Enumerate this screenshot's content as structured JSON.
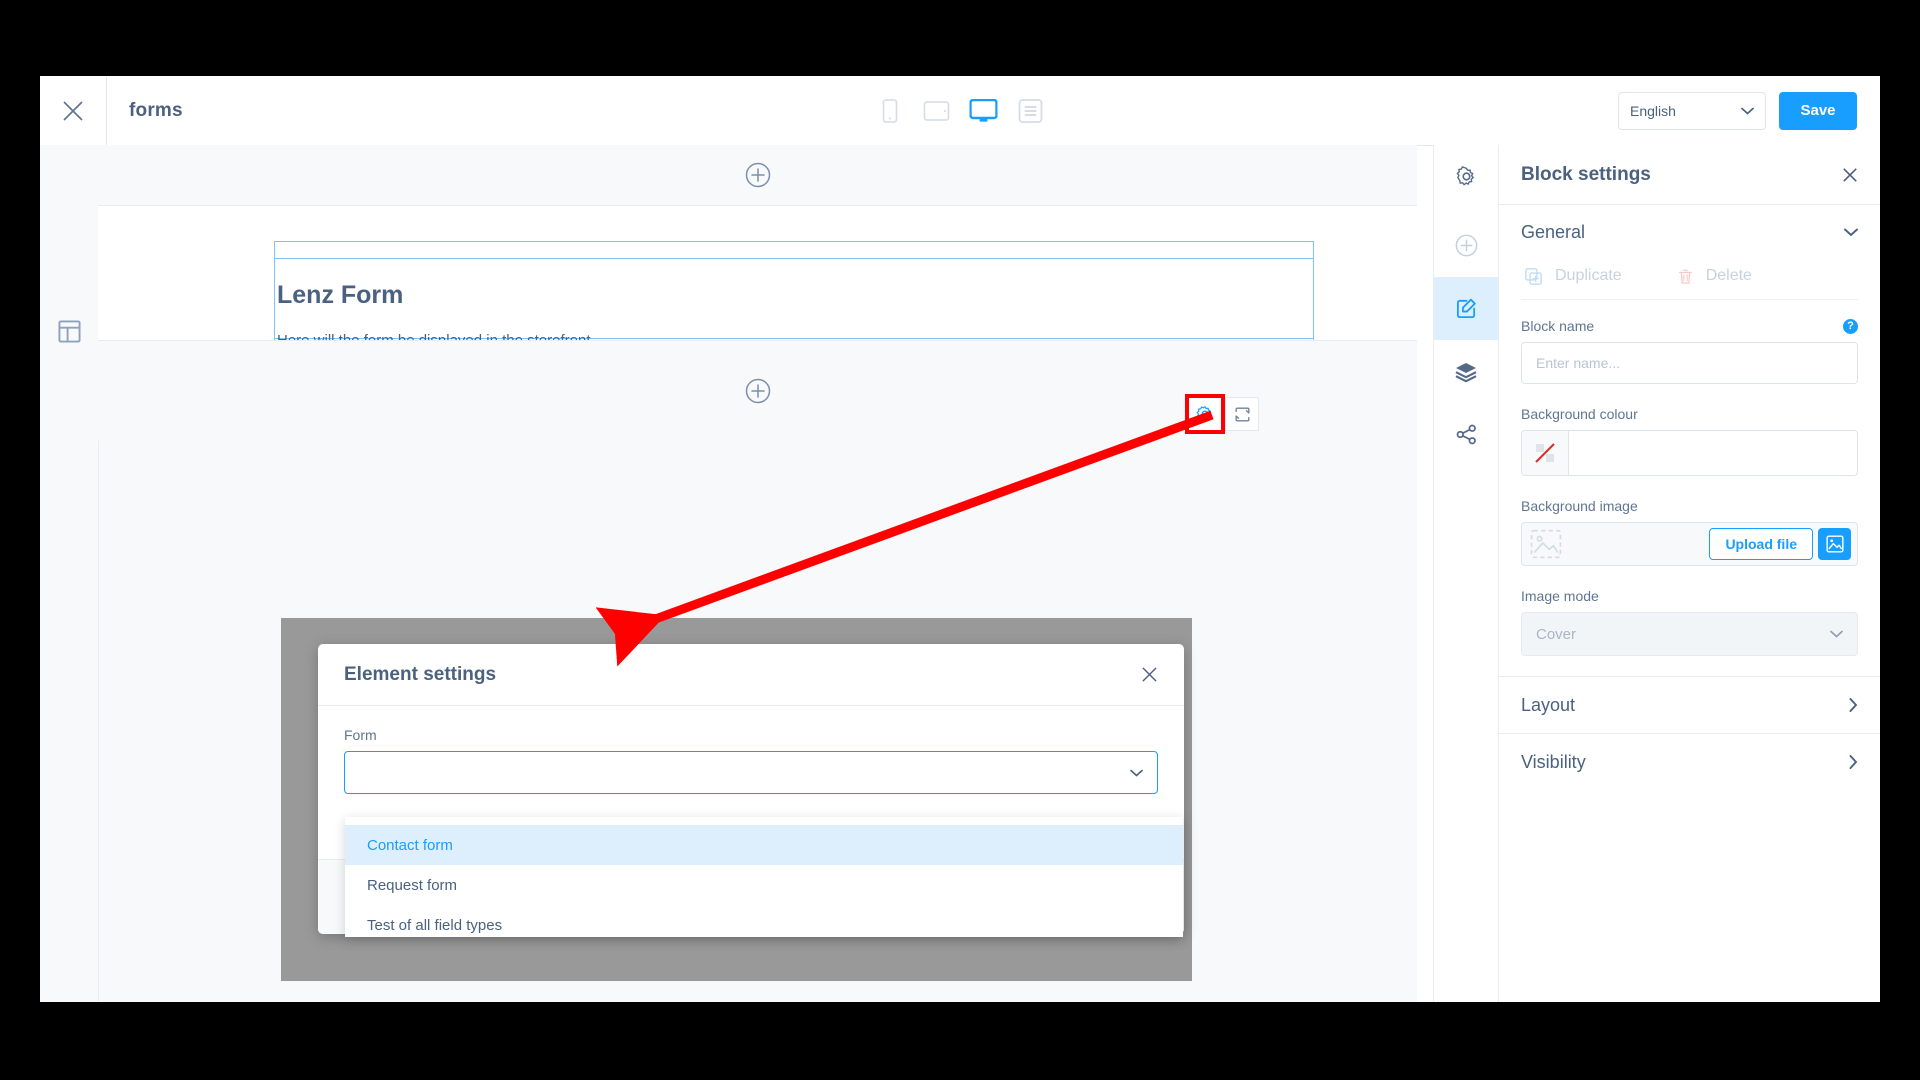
{
  "topbar": {
    "close_icon": "close-icon",
    "title": "forms",
    "devices": [
      {
        "name": "mobile-view",
        "icon": "mobile-icon",
        "active": false
      },
      {
        "name": "tablet-view",
        "icon": "tablet-icon",
        "active": false
      },
      {
        "name": "desktop-view",
        "icon": "desktop-icon",
        "active": true
      },
      {
        "name": "list-view",
        "icon": "list-icon",
        "active": false
      }
    ],
    "language": "English",
    "save_label": "Save"
  },
  "canvas": {
    "section_icon": "layout-icon",
    "add_block_label": "+",
    "block": {
      "heading": "Lenz Form",
      "description": "Here will the form be displayed in the storefront."
    },
    "tools": {
      "settings_icon": "gear-icon",
      "swap_icon": "swap-icon"
    }
  },
  "modal": {
    "title": "Element settings",
    "close_icon": "close-icon",
    "field_label": "Form",
    "selected_value": "",
    "chevron_icon": "chevron-down-icon",
    "options": [
      {
        "label": "Contact form",
        "selected": true
      },
      {
        "label": "Request form",
        "selected": false
      },
      {
        "label": "Test of all field types",
        "selected": false
      }
    ]
  },
  "rail": {
    "items": [
      {
        "name": "sidebar-item-settings",
        "icon": "gear-icon",
        "active": false
      },
      {
        "name": "sidebar-item-add",
        "icon": "plus-circle-icon",
        "active": false
      },
      {
        "name": "sidebar-item-block",
        "icon": "edit-block-icon",
        "active": true
      },
      {
        "name": "sidebar-item-layers",
        "icon": "layers-icon",
        "active": false
      },
      {
        "name": "sidebar-item-share",
        "icon": "share-icon",
        "active": false
      }
    ]
  },
  "panel": {
    "title": "Block settings",
    "close_icon": "close-icon",
    "general": {
      "label": "General",
      "chevron_icon": "chevron-down-icon",
      "duplicate_label": "Duplicate",
      "duplicate_icon": "duplicate-icon",
      "delete_label": "Delete",
      "delete_icon": "trash-icon",
      "block_name_label": "Block name",
      "block_name_value": "",
      "block_name_placeholder": "Enter name...",
      "help_icon": "?",
      "background_colour_label": "Background colour",
      "background_colour_value": "",
      "background_colour_swatch_icon": "no-colour-icon",
      "background_image_label": "Background image",
      "background_image_thumb_icon": "image-placeholder-icon",
      "upload_label": "Upload file",
      "media_picker_icon": "media-icon",
      "image_mode_label": "Image mode",
      "image_mode_value": "Cover",
      "image_mode_chevron": "chevron-down-icon"
    },
    "sections": [
      {
        "label": "Layout",
        "chevron_icon": "chevron-right-icon"
      },
      {
        "label": "Visibility",
        "chevron_icon": "chevron-right-icon"
      }
    ]
  },
  "annotation": {
    "arrow_colour": "#ff0000",
    "highlight_colour": "#ff0000"
  }
}
